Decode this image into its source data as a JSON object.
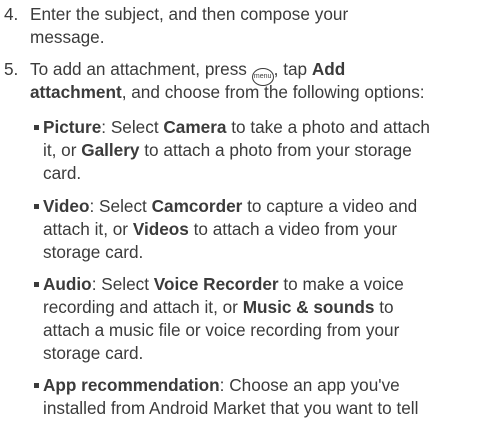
{
  "steps": [
    {
      "number": "4.",
      "lines": [
        "Enter the subject, and then compose your",
        "message."
      ]
    },
    {
      "number": "5.",
      "line1_pre": "To add an attachment, press ",
      "menu_icon_label": "menu",
      "line1_mid": ", tap ",
      "line1_bold": "Add",
      "line2_bold": "attachment",
      "line2_rest": ", and choose from the following options:"
    }
  ],
  "options": [
    {
      "term": "Picture",
      "lines": [
        [
          {
            "t": ": Select "
          },
          {
            "t": "Camera",
            "b": true
          },
          {
            "t": " to take a photo and attach"
          }
        ],
        [
          {
            "t": "it, or "
          },
          {
            "t": "Gallery",
            "b": true
          },
          {
            "t": " to attach a photo from your storage"
          }
        ],
        [
          {
            "t": "card."
          }
        ]
      ]
    },
    {
      "term": "Video",
      "lines": [
        [
          {
            "t": ": Select "
          },
          {
            "t": "Camcorder",
            "b": true
          },
          {
            "t": " to capture a video and"
          }
        ],
        [
          {
            "t": "attach it, or "
          },
          {
            "t": "Videos",
            "b": true
          },
          {
            "t": " to attach a video from your"
          }
        ],
        [
          {
            "t": "storage card."
          }
        ]
      ]
    },
    {
      "term": "Audio",
      "lines": [
        [
          {
            "t": ": Select "
          },
          {
            "t": "Voice Recorder",
            "b": true
          },
          {
            "t": " to make a voice"
          }
        ],
        [
          {
            "t": "recording and attach it, or "
          },
          {
            "t": "Music & sounds",
            "b": true
          },
          {
            "t": " to"
          }
        ],
        [
          {
            "t": "attach a music file or voice recording from your"
          }
        ],
        [
          {
            "t": "storage card."
          }
        ]
      ]
    },
    {
      "term": "App recommendation",
      "lines": [
        [
          {
            "t": ": Choose an app you've"
          }
        ],
        [
          {
            "t": "installed from Android Market that you want to tell"
          }
        ]
      ]
    }
  ]
}
